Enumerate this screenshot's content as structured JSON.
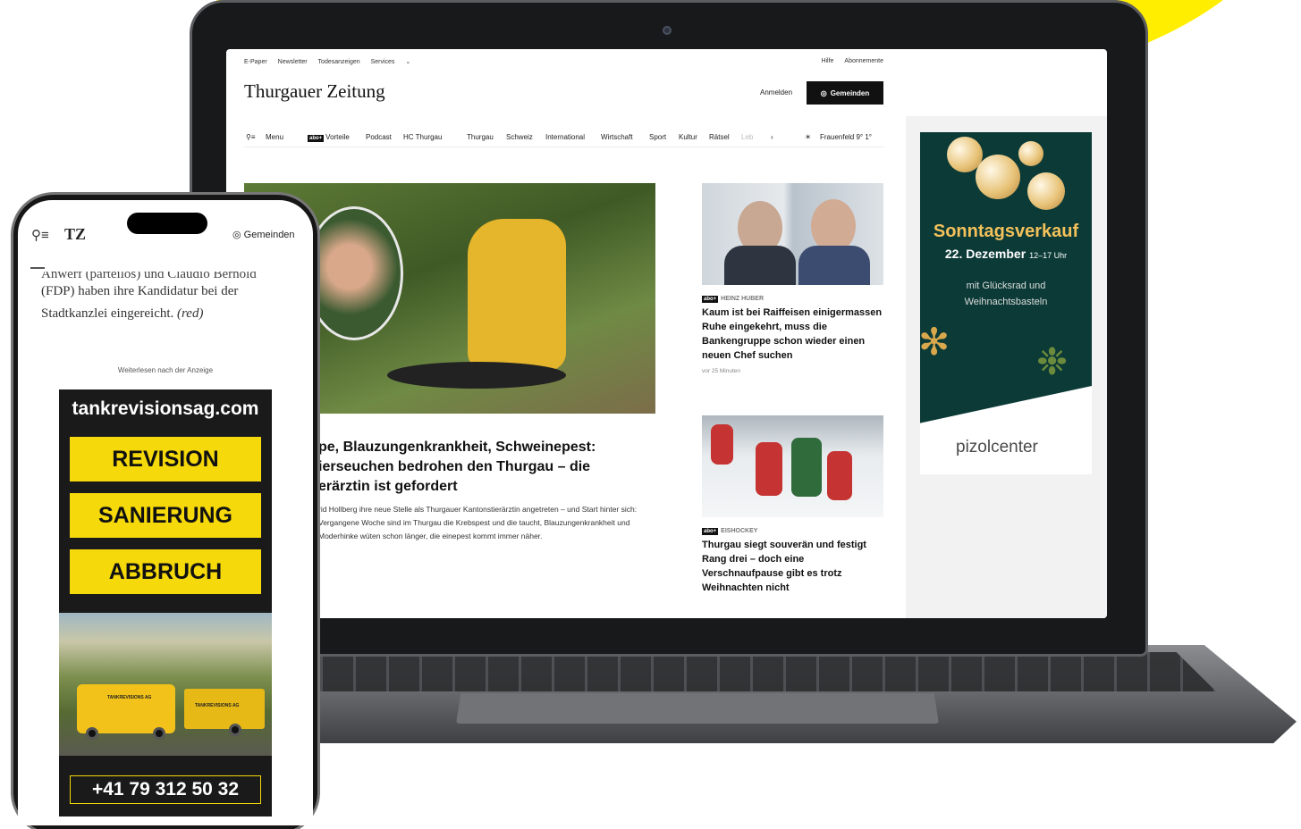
{
  "desktop": {
    "top_links": [
      "E-Paper",
      "Newsletter",
      "Todesanzeigen",
      "Services"
    ],
    "top_links_right": [
      "Hilfe",
      "Abonnemente"
    ],
    "logo": "Thurgauer Zeitung",
    "login": "Anmelden",
    "gemeinden_button": "Gemeinden",
    "menu_label": "Menu",
    "nav": [
      "Vorteile",
      "Podcast",
      "HC Thurgau",
      "Thurgau",
      "Schweiz",
      "International",
      "Wirtschaft",
      "Sport",
      "Kultur",
      "Rätsel",
      "Leb"
    ],
    "abo_badge": "abo+",
    "weather": "Frauenfeld 9° 1°",
    "hero": {
      "headline": "pe, Blauzungenkrankheit, Schweinepest: ierseuchen bedrohen den Thurgau – die erärztin ist gefordert",
      "lead": "rid Hollberg ihre neue Stelle als Thurgauer Kantonstierärztin angetreten – und Start hinter sich: Vergangene Woche sind im Thurgau die Krebspest und die taucht, Blauzungenkrankheit und Moderhinke wüten schon länger, die einepest kommt immer näher."
    },
    "side_articles": [
      {
        "author": "HEINZ HUBER",
        "title": "Kaum ist bei Raiffeisen einigermassen Ruhe eingekehrt, muss die Bankengruppe schon wieder einen neuen Chef suchen",
        "time": "vor 25 Minuten"
      },
      {
        "author": "EISHOCKEY",
        "title": "Thurgau siegt souverän und festigt Rang drei – doch eine Verschnaufpause gibt es trotz Weihnachten nicht",
        "time": ""
      }
    ],
    "ad": {
      "title": "Sonntagsverkauf",
      "date": "22. Dezember",
      "time": "12–17 Uhr",
      "subtitle": "mit Glücksrad und Weihnachtsbasteln",
      "brand": "pizolcenter"
    }
  },
  "mobile": {
    "logo": "TZ",
    "gemeinden": "Gemeinden",
    "article_text_cut": "Anwerf (parteilos) und Claudio Bernold",
    "article_text": "(FDP) haben ihre Kandidatur bei der Stadtkanzlei eingereicht.",
    "article_source": "(red)",
    "ad_note": "Weiterlesen nach der Anzeige",
    "ad": {
      "url": "tankrevisionsag.com",
      "buttons": [
        "REVISION",
        "SANIERUNG",
        "ABBRUCH"
      ],
      "truck_label": "TANKREVISIONS AG",
      "phone": "+41 79 312 50 32"
    }
  }
}
